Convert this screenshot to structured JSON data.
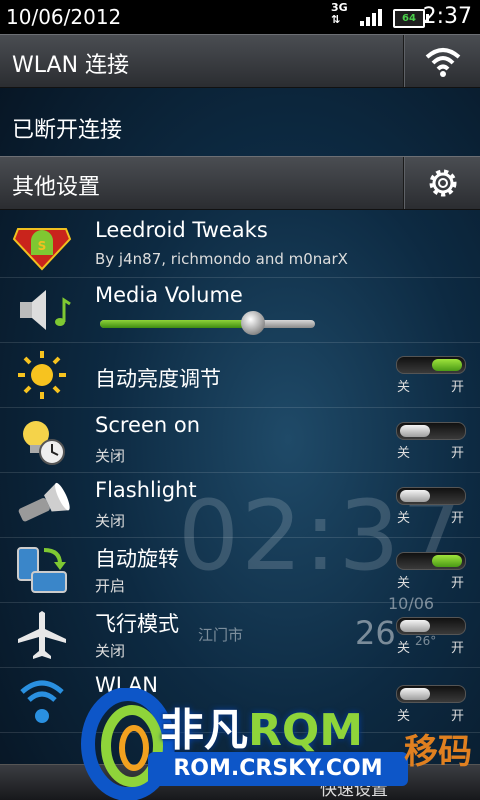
{
  "status_bar": {
    "date": "10/06/2012",
    "network": "3G",
    "battery": "64",
    "time": "2:37"
  },
  "wlan_header": {
    "label": "WLAN 连接",
    "icon": "wifi-icon"
  },
  "wlan_status": "已断开连接",
  "other_header": {
    "label": "其他设置",
    "icon": "gear-icon"
  },
  "rows": [
    {
      "title": "Leedroid Tweaks",
      "subtitle": "By j4n87, richmondo and m0narX",
      "icon": "superman-android-icon"
    },
    {
      "title": "Media Volume",
      "icon": "speaker-icon",
      "volume_level": 0.71
    },
    {
      "title": "自动亮度调节",
      "icon": "sun-icon",
      "toggle_on": true,
      "off_label": "关",
      "on_label": "开"
    },
    {
      "title": "Screen on",
      "subtitle": "关闭",
      "icon": "bulb-clock-icon",
      "toggle_on": false,
      "off_label": "关",
      "on_label": "开"
    },
    {
      "title": "Flashlight",
      "subtitle": "关闭",
      "icon": "flashlight-icon",
      "toggle_on": false,
      "off_label": "关",
      "on_label": "开"
    },
    {
      "title": "自动旋转",
      "subtitle": "开启",
      "icon": "rotate-icon",
      "toggle_on": true,
      "off_label": "关",
      "on_label": "开"
    },
    {
      "title": "飞行模式",
      "subtitle": "关闭",
      "icon": "airplane-icon",
      "toggle_on": false,
      "off_label": "关",
      "on_label": "开"
    },
    {
      "title": "WLAN",
      "icon": "wifi-icon",
      "toggle_on": false,
      "off_label": "关",
      "on_label": "开"
    }
  ],
  "widget": {
    "clock": "02:37",
    "date": "10/06",
    "city": "江门市",
    "temp": "26",
    "temp_small": "26°"
  },
  "bottom_tabs": {
    "right": "快速设置"
  },
  "watermark": {
    "brand_a": "非凡",
    "brand_b": "RQM",
    "url": "ROM.CRSKY.COM",
    "side": "移码"
  },
  "colors": {
    "toggle_on": "#6cc21f",
    "accent_blue": "#0d56c8"
  }
}
